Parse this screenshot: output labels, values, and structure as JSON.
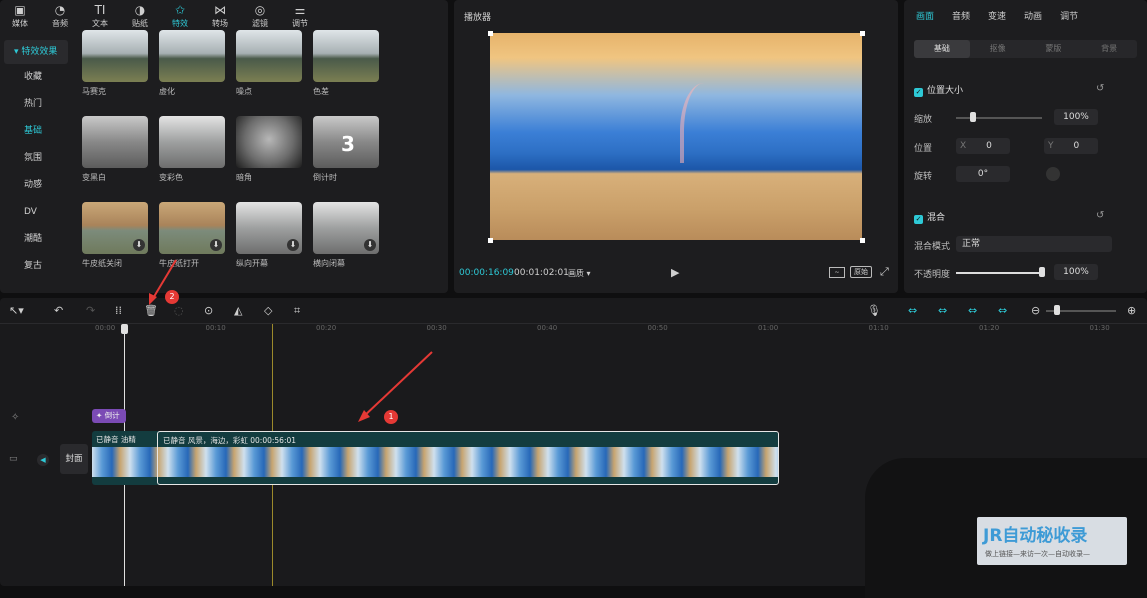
{
  "toolbar": [
    {
      "label": "媒体",
      "icon": "media-icon"
    },
    {
      "label": "音频",
      "icon": "audio-icon"
    },
    {
      "label": "文本",
      "icon": "text-icon"
    },
    {
      "label": "贴纸",
      "icon": "sticker-icon"
    },
    {
      "label": "特效",
      "icon": "effects-icon",
      "active": true
    },
    {
      "label": "转场",
      "icon": "transition-icon"
    },
    {
      "label": "滤镜",
      "icon": "filter-icon"
    },
    {
      "label": "调节",
      "icon": "adjust-icon"
    }
  ],
  "sidebar": {
    "header": "▾ 特效效果",
    "items": [
      "收藏",
      "热门",
      "基础",
      "氛围",
      "动感",
      "DV",
      "潮酷",
      "复古"
    ],
    "active": "基础"
  },
  "effects": [
    [
      "马赛克",
      "虚化",
      "噪点",
      "色差"
    ],
    [
      "变黑白",
      "变彩色",
      "暗角",
      "倒计时"
    ],
    [
      "牛皮纸关闭",
      "牛皮纸打开",
      "纵向开幕",
      "横向闭幕"
    ]
  ],
  "countdown_digit": "3",
  "player": {
    "title": "播放器",
    "current_time": "00:00:16:09",
    "total_time": "00:01:02:01",
    "ratio": "画质 ▾",
    "ratio_btn": "原始"
  },
  "props": {
    "tabs": [
      "画面",
      "音频",
      "变速",
      "动画",
      "调节"
    ],
    "active_tab": "画面",
    "subtabs": [
      "基础",
      "抠像",
      "蒙版",
      "背景"
    ],
    "position_size": "位置大小",
    "scale_label": "缩放",
    "scale": "100%",
    "position_label": "位置",
    "x_label": "X",
    "x": "0",
    "y_label": "Y",
    "y": "0",
    "rotate_label": "旋转",
    "rotate": "0°",
    "blend": "混合",
    "blend_mode_label": "混合模式",
    "blend_mode": "正常",
    "opacity_label": "不透明度",
    "opacity": "100%"
  },
  "timeline": {
    "ruler": [
      "00:00",
      "00:10",
      "00:20",
      "00:30",
      "00:40",
      "00:50",
      "01:00",
      "01:10",
      "01:20",
      "01:30"
    ],
    "effect_clip": "倒计",
    "cover": "封面",
    "clip_small": "已静音  油精",
    "clip_main": "已静音  风景，海边，彩虹  00:00:56:01",
    "annotation_1": "1",
    "annotation_2": "2"
  },
  "colors": {
    "accent": "#2ec9d6",
    "annotation": "#e53935",
    "effect_clip": "#7b4bb5",
    "main_clip": "#133c3f"
  },
  "watermark": {
    "brand": "JR自动秘收录",
    "sub": "做上链接—来访一次—自动收录—"
  }
}
